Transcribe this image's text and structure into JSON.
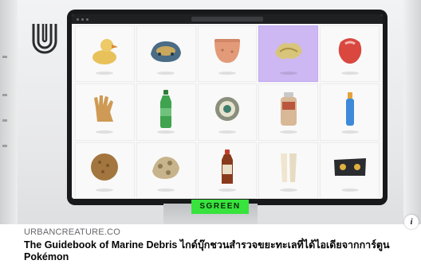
{
  "post": {
    "link_domain": "URBANCREATURE.CO",
    "link_title": "The Guidebook of Marine Debris ไกด์บุ๊กชวนสำรวจขยะทะเลที่ได้ไอเดียจากการ์ตูน Pokémon",
    "info_label": "i"
  },
  "hero": {
    "badge_text": "SGREEN",
    "browser_url": "",
    "highlight_color": "#cdb8f3",
    "badge_color": "#37e33c",
    "items": [
      {
        "name": "rubber-duck-toy-icon"
      },
      {
        "name": "old-shoe-icon"
      },
      {
        "name": "plastic-bowl-icon"
      },
      {
        "name": "fishing-net-debris-icon",
        "highlighted": true
      },
      {
        "name": "red-shell-icon"
      },
      {
        "name": "rubber-glove-icon"
      },
      {
        "name": "green-plastic-bottle-icon"
      },
      {
        "name": "can-lid-icon"
      },
      {
        "name": "plastic-jar-icon"
      },
      {
        "name": "blue-bottle-icon"
      },
      {
        "name": "sponge-icon"
      },
      {
        "name": "coral-debris-icon"
      },
      {
        "name": "syrup-bottle-icon"
      },
      {
        "name": "white-container-icon"
      },
      {
        "name": "black-mask-icon"
      }
    ]
  }
}
